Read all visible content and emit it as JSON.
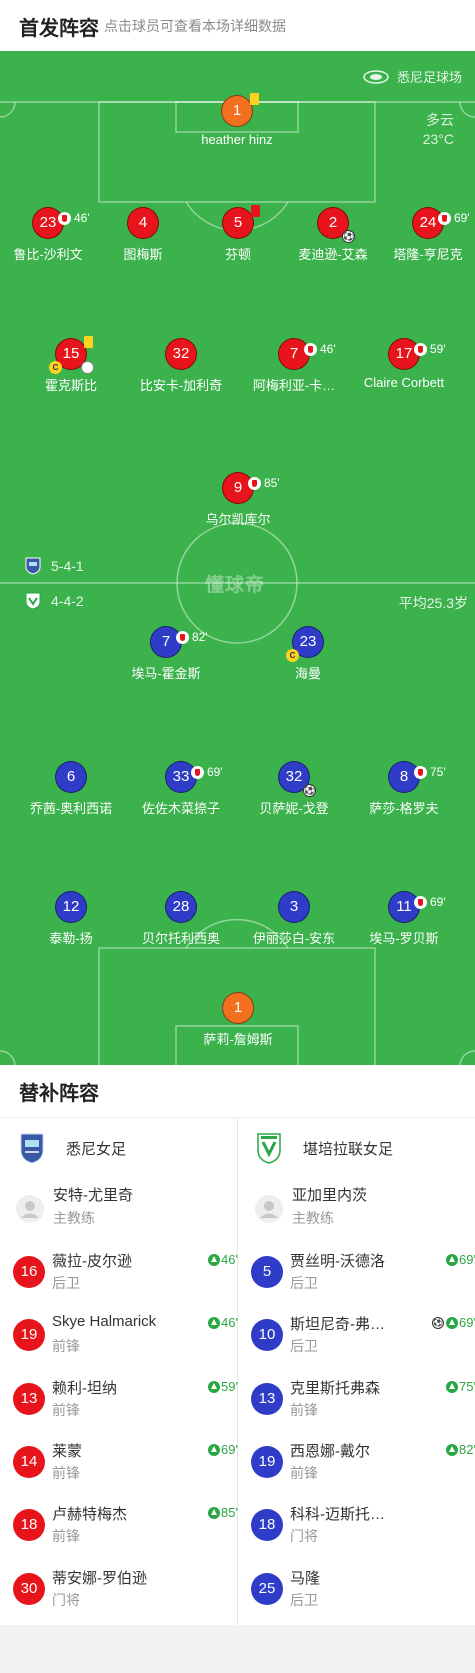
{
  "header": {
    "title": "首发阵容",
    "subtitle": "点击球员可查看本场详细数据"
  },
  "pitch": {
    "stadium": "悉尼足球场",
    "weather": "多云",
    "temperature": "23°C",
    "watermark": "懂球帝",
    "home_formation": "5-4-1",
    "away_formation": "4-4-2",
    "avg_age": "平均25.3岁"
  },
  "home_players": [
    {
      "num": "1",
      "name": "heather hinz",
      "card": "yellow",
      "color": "orange"
    },
    {
      "num": "23",
      "name": "鲁比-沙利文",
      "sub_min": "46'"
    },
    {
      "num": "4",
      "name": "图梅斯"
    },
    {
      "num": "5",
      "name": "芬顿",
      "card": "red"
    },
    {
      "num": "2",
      "name": "麦迪逊-艾森",
      "goal": true
    },
    {
      "num": "24",
      "name": "塔隆-亨尼克",
      "sub_min": "69'"
    },
    {
      "num": "15",
      "name": "霍克斯比",
      "card": "yellow",
      "captain": "C"
    },
    {
      "num": "32",
      "name": "比安卡-加利奇"
    },
    {
      "num": "7",
      "name": "阿梅利亚-卡…",
      "sub_min": "46'"
    },
    {
      "num": "17",
      "name": "Claire Corbett",
      "sub_min": "59'"
    },
    {
      "num": "9",
      "name": "乌尔凯库尔",
      "sub_min": "85'"
    }
  ],
  "away_players": [
    {
      "num": "7",
      "name": "埃马-霍金斯",
      "sub_min": "82'"
    },
    {
      "num": "23",
      "name": "海曼",
      "captain": "C"
    },
    {
      "num": "6",
      "name": "乔茜-奥利西诺"
    },
    {
      "num": "33",
      "name": "佐佐木菜捺子",
      "sub_min": "69'"
    },
    {
      "num": "32",
      "name": "贝萨妮-戈登",
      "goal": true
    },
    {
      "num": "8",
      "name": "萨莎-格罗夫",
      "sub_min": "75'"
    },
    {
      "num": "12",
      "name": "泰勒-扬"
    },
    {
      "num": "28",
      "name": "贝尔托利西奥"
    },
    {
      "num": "3",
      "name": "伊丽莎白-安东"
    },
    {
      "num": "11",
      "name": "埃马-罗贝斯",
      "sub_min": "69'"
    },
    {
      "num": "1",
      "name": "萨莉-詹姆斯",
      "color": "orange"
    }
  ],
  "subs": {
    "title": "替补阵容",
    "home": {
      "team": "悉尼女足",
      "coach": {
        "name": "安特-尤里奇",
        "role": "主教练"
      },
      "players": [
        {
          "num": "16",
          "name": "薇拉-皮尔逊",
          "pos": "后卫",
          "in": "46'"
        },
        {
          "num": "19",
          "name": "Skye Halmarick",
          "pos": "前锋",
          "in": "46'"
        },
        {
          "num": "13",
          "name": "赖利-坦纳",
          "pos": "前锋",
          "in": "59'"
        },
        {
          "num": "14",
          "name": "莱蒙",
          "pos": "前锋",
          "in": "69'"
        },
        {
          "num": "18",
          "name": "卢赫特梅杰",
          "pos": "前锋",
          "in": "85'"
        },
        {
          "num": "30",
          "name": "蒂安娜-罗伯逊",
          "pos": "门将",
          "in": ""
        }
      ]
    },
    "away": {
      "team": "堪培拉联女足",
      "coach": {
        "name": "亚加里内茨",
        "role": "主教练"
      },
      "players": [
        {
          "num": "5",
          "name": "贾丝明-沃德洛",
          "pos": "后卫",
          "in": "69'"
        },
        {
          "num": "10",
          "name": "斯坦尼奇-弗…",
          "pos": "后卫",
          "in": "69'",
          "goal": true
        },
        {
          "num": "13",
          "name": "克里斯托弗森",
          "pos": "前锋",
          "in": "75'"
        },
        {
          "num": "19",
          "name": "西恩娜-戴尔",
          "pos": "前锋",
          "in": "82'"
        },
        {
          "num": "18",
          "name": "科科-迈斯托…",
          "pos": "门将",
          "in": ""
        },
        {
          "num": "25",
          "name": "马隆",
          "pos": "后卫",
          "in": ""
        }
      ]
    }
  },
  "colors": {
    "pitch": "#3bb24c",
    "home": "#e8141c",
    "away": "#2e3cc8",
    "keeper": "#f37021",
    "sub_in": "#2aa644"
  }
}
